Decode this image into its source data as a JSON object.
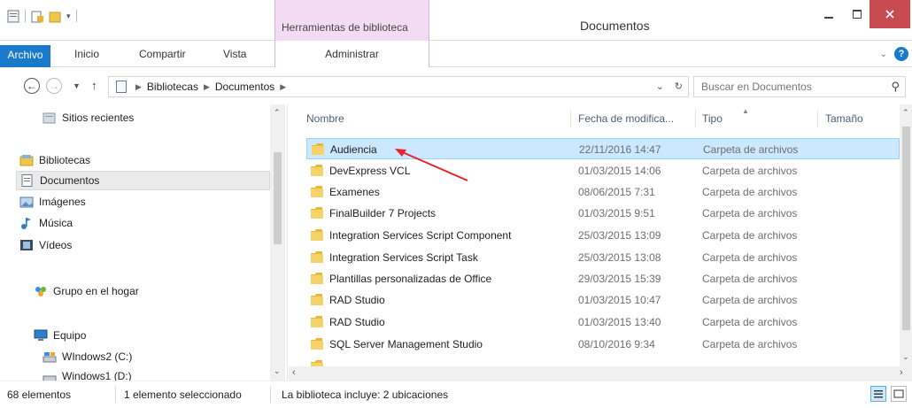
{
  "window": {
    "title": "Documentos",
    "context_group_title": "Herramientas de biblioteca"
  },
  "ribbon": {
    "tabs": {
      "file": "Archivo",
      "home": "Inicio",
      "share": "Compartir",
      "view": "Vista",
      "manage": "Administrar"
    },
    "help_label": "?"
  },
  "address": {
    "crumbs": [
      "Bibliotecas",
      "Documentos"
    ],
    "search_placeholder": "Buscar en Documentos"
  },
  "nav": {
    "items": [
      {
        "label": "Sitios recientes",
        "icon": "recent-places-icon"
      },
      {
        "label": "Bibliotecas",
        "icon": "libraries-icon"
      },
      {
        "label": "Documentos",
        "icon": "documents-icon"
      },
      {
        "label": "Imágenes",
        "icon": "pictures-icon"
      },
      {
        "label": "Música",
        "icon": "music-icon"
      },
      {
        "label": "Vídeos",
        "icon": "videos-icon"
      },
      {
        "label": "Grupo en el hogar",
        "icon": "homegroup-icon"
      },
      {
        "label": "Equipo",
        "icon": "computer-icon"
      },
      {
        "label": "WIndows2 (C:)",
        "icon": "drive-icon"
      },
      {
        "label": "Windows1 (D:)",
        "icon": "drive-icon"
      }
    ]
  },
  "files": {
    "columns": [
      "Nombre",
      "Fecha de modifica...",
      "Tipo",
      "Tamaño"
    ],
    "rows": [
      {
        "name": "Audiencia",
        "date": "22/11/2016 14:47",
        "type": "Carpeta de archivos"
      },
      {
        "name": "DevExpress VCL",
        "date": "01/03/2015 14:06",
        "type": "Carpeta de archivos"
      },
      {
        "name": "Examenes",
        "date": "08/06/2015 7:31",
        "type": "Carpeta de archivos"
      },
      {
        "name": "FinalBuilder 7 Projects",
        "date": "01/03/2015 9:51",
        "type": "Carpeta de archivos"
      },
      {
        "name": "Integration Services Script Component",
        "date": "25/03/2015 13:09",
        "type": "Carpeta de archivos"
      },
      {
        "name": "Integration Services Script Task",
        "date": "25/03/2015 13:08",
        "type": "Carpeta de archivos"
      },
      {
        "name": "Plantillas personalizadas de Office",
        "date": "29/03/2015 15:39",
        "type": "Carpeta de archivos"
      },
      {
        "name": "RAD Studio",
        "date": "01/03/2015 10:47",
        "type": "Carpeta de archivos"
      },
      {
        "name": "RAD Studio",
        "date": "01/03/2015 13:40",
        "type": "Carpeta de archivos"
      },
      {
        "name": "SQL Server Management Studio",
        "date": "08/10/2016 9:34",
        "type": "Carpeta de archivos"
      }
    ]
  },
  "status": {
    "count": "68 elementos",
    "selection": "1 elemento seleccionado",
    "library_info": "La biblioteca incluye: 2 ubicaciones"
  },
  "colors": {
    "accent": "#1979ca",
    "selected_row": "#cce8ff",
    "context_tab": "#f3dcf3",
    "close_button": "#c74b50",
    "annotation_arrow": "#e8222a"
  }
}
